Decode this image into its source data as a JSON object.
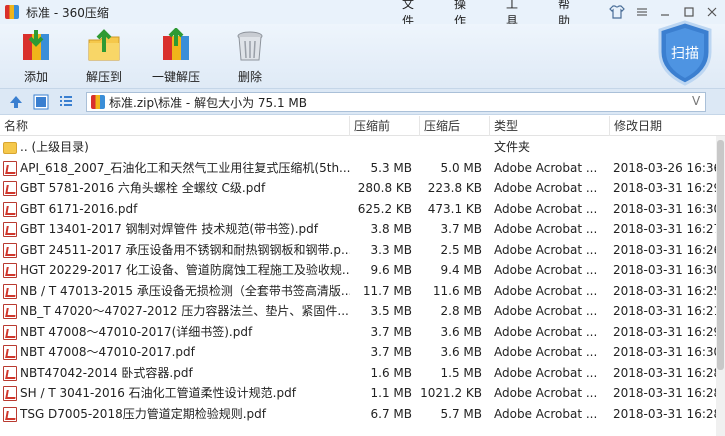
{
  "window": {
    "title": "标准 - 360压缩"
  },
  "menu": [
    "文件",
    "操作",
    "工具",
    "帮助"
  ],
  "toolbar": {
    "buttons": [
      {
        "label": "添加",
        "icon": "add-archive-icon"
      },
      {
        "label": "解压到",
        "icon": "extract-to-icon"
      },
      {
        "label": "一键解压",
        "icon": "one-click-extract-icon"
      },
      {
        "label": "删除",
        "icon": "trash-icon"
      }
    ],
    "scan_label": "扫描"
  },
  "address": {
    "path": "标准.zip\\标准 - 解包大小为 75.1 MB",
    "dropdown": "V"
  },
  "columns": {
    "name": "名称",
    "packed": "压缩前",
    "original": "压缩后",
    "type": "类型",
    "modified": "修改日期"
  },
  "files": [
    {
      "name": ".. (上级目录)",
      "packed": "",
      "original": "",
      "type": "文件夹",
      "date": "",
      "icon": "folder-icon"
    },
    {
      "name": "API_618_2007_石油化工和天然气工业用往复式压缩机(5th...",
      "packed": "5.3 MB",
      "original": "5.0 MB",
      "type": "Adobe Acrobat ...",
      "date": "2018-03-26 16:36",
      "icon": "pdf-icon"
    },
    {
      "name": "GBT 5781-2016 六角头螺栓 全螺纹 C级.pdf",
      "packed": "280.8 KB",
      "original": "223.8 KB",
      "type": "Adobe Acrobat ...",
      "date": "2018-03-31 16:29",
      "icon": "pdf-icon"
    },
    {
      "name": "GBT 6171-2016.pdf",
      "packed": "625.2 KB",
      "original": "473.1 KB",
      "type": "Adobe Acrobat ...",
      "date": "2018-03-31 16:30",
      "icon": "pdf-icon"
    },
    {
      "name": "GBT 13401-2017 钢制对焊管件 技术规范(带书签).pdf",
      "packed": "3.8 MB",
      "original": "3.7 MB",
      "type": "Adobe Acrobat ...",
      "date": "2018-03-31 16:27",
      "icon": "pdf-icon"
    },
    {
      "name": "GBT 24511-2017 承压设备用不锈钢和耐热钢钢板和钢带.p...",
      "packed": "3.3 MB",
      "original": "2.5 MB",
      "type": "Adobe Acrobat ...",
      "date": "2018-03-31 16:26",
      "icon": "pdf-icon"
    },
    {
      "name": "HGT 20229-2017 化工设备、管道防腐蚀工程施工及验收规...",
      "packed": "9.6 MB",
      "original": "9.4 MB",
      "type": "Adobe Acrobat ...",
      "date": "2018-03-31 16:30",
      "icon": "pdf-icon"
    },
    {
      "name": "NB / T 47013-2015 承压设备无损检测（全套带书签高清版...",
      "packed": "11.7 MB",
      "original": "11.6 MB",
      "type": "Adobe Acrobat ...",
      "date": "2018-03-31 16:25",
      "icon": "pdf-icon"
    },
    {
      "name": "NB_T 47020～47027-2012 压力容器法兰、垫片、紧固件...",
      "packed": "3.5 MB",
      "original": "2.8 MB",
      "type": "Adobe Acrobat ...",
      "date": "2018-03-31 16:21",
      "icon": "pdf-icon"
    },
    {
      "name": "NBT 47008～47010-2017(详细书签).pdf",
      "packed": "3.7 MB",
      "original": "3.6 MB",
      "type": "Adobe Acrobat ...",
      "date": "2018-03-31 16:29",
      "icon": "pdf-icon"
    },
    {
      "name": "NBT 47008～47010-2017.pdf",
      "packed": "3.7 MB",
      "original": "3.6 MB",
      "type": "Adobe Acrobat ...",
      "date": "2018-03-31 16:30",
      "icon": "pdf-icon"
    },
    {
      "name": "NBT47042-2014 卧式容器.pdf",
      "packed": "1.6 MB",
      "original": "1.5 MB",
      "type": "Adobe Acrobat ...",
      "date": "2018-03-31 16:28",
      "icon": "pdf-icon"
    },
    {
      "name": "SH / T 3041-2016 石油化工管道柔性设计规范.pdf",
      "packed": "1.1 MB",
      "original": "1021.2 KB",
      "type": "Adobe Acrobat ...",
      "date": "2018-03-31 16:28",
      "icon": "pdf-icon"
    },
    {
      "name": "TSG D7005-2018压力管道定期检验规则.pdf",
      "packed": "6.7 MB",
      "original": "5.7 MB",
      "type": "Adobe Acrobat ...",
      "date": "2018-03-31 16:28",
      "icon": "pdf-icon"
    }
  ]
}
